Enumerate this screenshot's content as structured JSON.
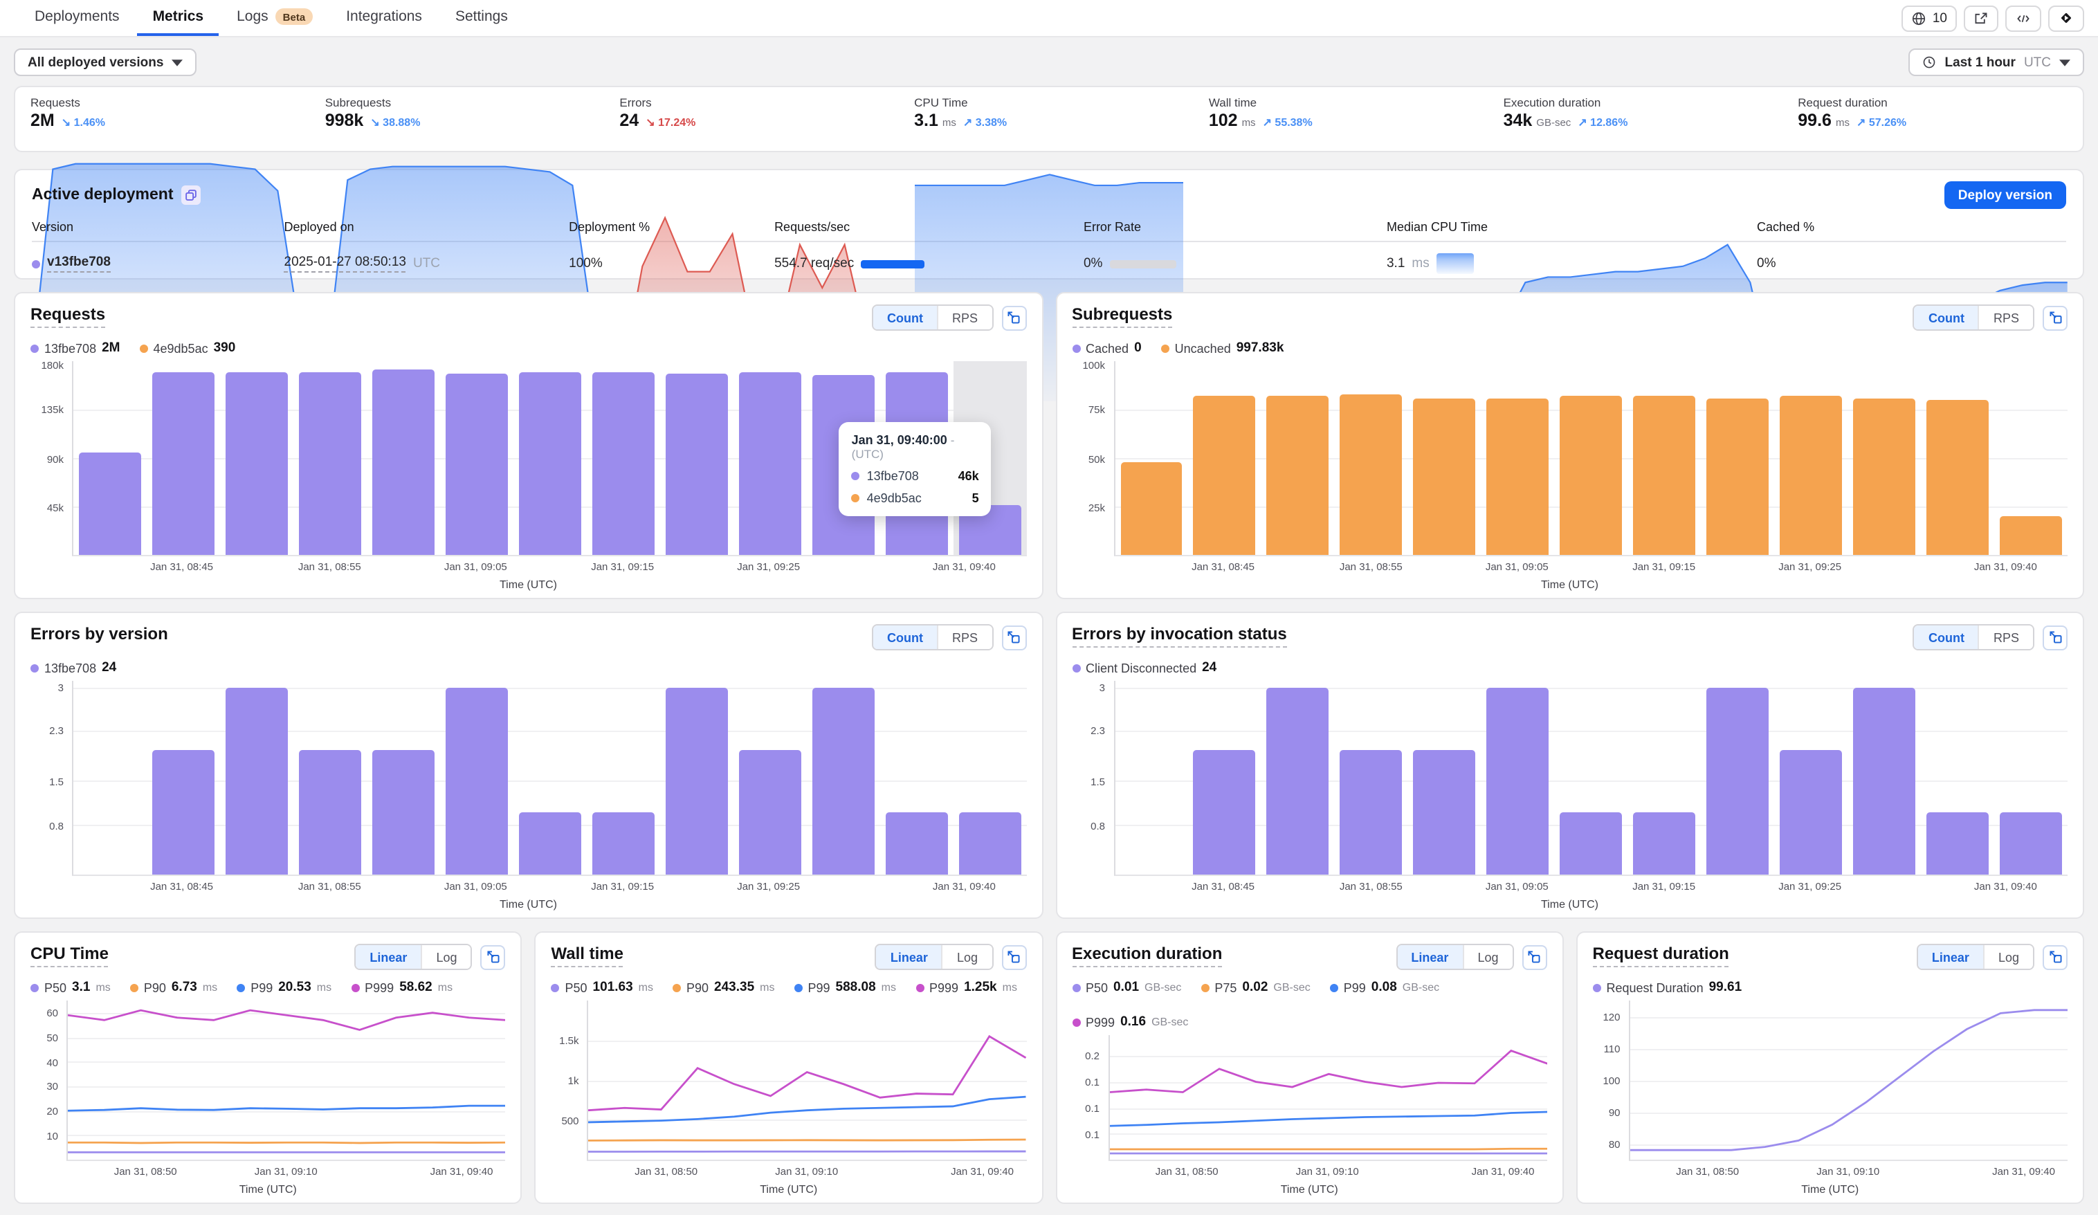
{
  "nav": {
    "tabs": [
      {
        "label": "Deployments",
        "active": false
      },
      {
        "label": "Metrics",
        "active": true
      },
      {
        "label": "Logs",
        "active": false,
        "badge": "Beta"
      },
      {
        "label": "Integrations",
        "active": false
      },
      {
        "label": "Settings",
        "active": false
      }
    ],
    "globe_count": "10"
  },
  "filters": {
    "versions": "All deployed versions",
    "time_range": "Last 1 hour",
    "time_zone": "UTC"
  },
  "colors": {
    "accent_blue": "#1467f2",
    "toggle_blue": "#1d64d8",
    "purple": "#9b8ced",
    "orange": "#f5a34f",
    "line_blue": "#3f83f4",
    "magenta": "#c750cb",
    "red": "#d64949"
  },
  "stats": [
    {
      "label": "Requests",
      "value": "2M",
      "unit": "",
      "arrow": "↘",
      "change": "1.46%",
      "change_color": "#4a90f5",
      "spark_color": "#3f83f4",
      "spark": [
        8,
        86,
        88,
        88,
        88,
        88,
        88,
        88,
        88,
        87,
        86,
        78,
        25
      ]
    },
    {
      "label": "Subrequests",
      "value": "998k",
      "unit": "",
      "arrow": "↘",
      "change": "38.88%",
      "change_color": "#4a90f5",
      "spark_color": "#3f83f4",
      "spark": [
        10,
        82,
        86,
        87,
        87,
        87,
        87,
        87,
        87,
        86,
        85,
        80,
        22
      ]
    },
    {
      "label": "Errors",
      "value": "24",
      "unit": "",
      "arrow": "↘",
      "change": "17.24%",
      "change_color": "#d64949",
      "spark_color": "#dd5a52",
      "spark": [
        5,
        50,
        68,
        48,
        48,
        62,
        22,
        22,
        58,
        42,
        58,
        22,
        22
      ]
    },
    {
      "label": "CPU Time",
      "value": "3.1",
      "unit": "ms",
      "arrow": "↗",
      "change": "3.38%",
      "change_color": "#4a90f5",
      "spark_color": "#3f83f4",
      "spark": [
        80,
        80,
        80,
        80,
        80,
        82,
        84,
        82,
        80,
        80,
        81,
        81,
        81
      ]
    },
    {
      "label": "Wall time",
      "value": "102",
      "unit": "ms",
      "arrow": "↗",
      "change": "55.38%",
      "change_color": "#4a90f5",
      "spark_color": "#3f83f4",
      "spark": [
        16,
        16,
        16,
        17,
        17,
        18,
        19,
        20,
        22,
        26,
        30,
        33,
        34
      ]
    },
    {
      "label": "Execution duration",
      "value": "34k",
      "unit": "GB-sec",
      "arrow": "↗",
      "change": "12.86%",
      "change_color": "#4a90f5",
      "spark_color": "#3f83f4",
      "spark": [
        28,
        44,
        46,
        46,
        47,
        48,
        48,
        49,
        50,
        53,
        58,
        44,
        8
      ]
    },
    {
      "label": "Request duration",
      "value": "99.6",
      "unit": "ms",
      "arrow": "↗",
      "change": "57.26%",
      "change_color": "#4a90f5",
      "spark_color": "#3f83f4",
      "spark": [
        22,
        22,
        22,
        22,
        23,
        25,
        28,
        32,
        37,
        41,
        43,
        44,
        44
      ]
    }
  ],
  "active_deployment": {
    "title": "Active deployment",
    "deploy_button": "Deploy version",
    "columns": [
      "Version",
      "Deployed on",
      "Deployment %",
      "Requests/sec",
      "Error Rate",
      "Median CPU Time",
      "Cached %"
    ],
    "row": {
      "version": "v13fbe708",
      "deployed_on": "2025-01-27 08:50:13",
      "tz": "UTC",
      "deployment_pct": "100%",
      "rps": "554.7 req/sec",
      "error_rate": "0%",
      "median_cpu": "3.1",
      "median_cpu_unit": "ms",
      "cached_pct": "0%"
    }
  },
  "toggles": {
    "count": "Count",
    "rps": "RPS",
    "linear": "Linear",
    "log": "Log"
  },
  "panels": {
    "requests": {
      "title": "Requests",
      "legend": [
        {
          "name": "13fbe708",
          "value": "2M",
          "color": "#9b8ced"
        },
        {
          "name": "4e9db5ac",
          "value": "390",
          "color": "#f5a34f"
        }
      ],
      "tooltip": {
        "title": "Jan 31, 09:40:00",
        "zone": "- (UTC)",
        "rows": [
          {
            "name": "13fbe708",
            "value": "46k",
            "color": "#9b8ced"
          },
          {
            "name": "4e9db5ac",
            "value": "5",
            "color": "#f5a34f"
          }
        ]
      }
    },
    "subrequests": {
      "title": "Subrequests",
      "legend": [
        {
          "name": "Cached",
          "value": "0",
          "color": "#9b8ced"
        },
        {
          "name": "Uncached",
          "value": "997.83k",
          "color": "#f5a34f"
        }
      ]
    },
    "errors_by_version": {
      "title": "Errors by version",
      "legend": [
        {
          "name": "13fbe708",
          "value": "24",
          "color": "#9b8ced"
        }
      ]
    },
    "errors_by_invocation": {
      "title": "Errors by invocation status",
      "legend": [
        {
          "name": "Client Disconnected",
          "value": "24",
          "color": "#9b8ced"
        }
      ]
    },
    "cpu_time": {
      "title": "CPU Time",
      "legend": [
        {
          "name": "P50",
          "value": "3.1",
          "unit": "ms",
          "color": "#9b8ced"
        },
        {
          "name": "P90",
          "value": "6.73",
          "unit": "ms",
          "color": "#f5a34f"
        },
        {
          "name": "P99",
          "value": "20.53",
          "unit": "ms",
          "color": "#3f83f4"
        },
        {
          "name": "P999",
          "value": "58.62",
          "unit": "ms",
          "color": "#c750cb"
        }
      ]
    },
    "wall_time": {
      "title": "Wall time",
      "legend": [
        {
          "name": "P50",
          "value": "101.63",
          "unit": "ms",
          "color": "#9b8ced"
        },
        {
          "name": "P90",
          "value": "243.35",
          "unit": "ms",
          "color": "#f5a34f"
        },
        {
          "name": "P99",
          "value": "588.08",
          "unit": "ms",
          "color": "#3f83f4"
        },
        {
          "name": "P999",
          "value": "1.25k",
          "unit": "ms",
          "color": "#c750cb"
        }
      ]
    },
    "execution_duration": {
      "title": "Execution duration",
      "legend": [
        {
          "name": "P50",
          "value": "0.01",
          "unit": "GB-sec",
          "color": "#9b8ced"
        },
        {
          "name": "P75",
          "value": "0.02",
          "unit": "GB-sec",
          "color": "#f5a34f"
        },
        {
          "name": "P99",
          "value": "0.08",
          "unit": "GB-sec",
          "color": "#3f83f4"
        },
        {
          "name": "P999",
          "value": "0.16",
          "unit": "GB-sec",
          "color": "#c750cb"
        }
      ]
    },
    "request_duration": {
      "title": "Request duration",
      "legend": [
        {
          "name": "Request Duration",
          "value": "99.61",
          "color": "#9b8ced"
        }
      ]
    }
  },
  "chart_data": [
    {
      "id": "requests",
      "type": "bar",
      "title": "Requests",
      "color": "#9b8ced",
      "ymax": 180,
      "yticks": [
        {
          "label": "180k",
          "v": 180
        },
        {
          "label": "135k",
          "v": 135
        },
        {
          "label": "90k",
          "v": 90
        },
        {
          "label": "45k",
          "v": 45
        }
      ],
      "values": [
        95,
        170,
        170,
        170,
        172,
        168,
        170,
        170,
        168,
        170,
        167,
        170,
        46
      ],
      "value_unit": "k",
      "hover_index": 12,
      "xticks": [
        "Jan 31, 08:45",
        "Jan 31, 08:55",
        "Jan 31, 09:05",
        "Jan 31, 09:15",
        "Jan 31, 09:25",
        "Jan 31, 09:40"
      ],
      "xtick_pos": [
        0.115,
        0.27,
        0.423,
        0.577,
        0.73,
        0.935
      ],
      "xlabel": "Time (UTC)"
    },
    {
      "id": "subrequests",
      "type": "bar",
      "title": "Subrequests",
      "color": "#f5a34f",
      "ymax": 100,
      "yticks": [
        {
          "label": "100k",
          "v": 100
        },
        {
          "label": "75k",
          "v": 75
        },
        {
          "label": "50k",
          "v": 50
        },
        {
          "label": "25k",
          "v": 25
        }
      ],
      "values": [
        48,
        82,
        82,
        83,
        81,
        81,
        82,
        82,
        81,
        82,
        81,
        80,
        20
      ],
      "value_unit": "k",
      "xticks": [
        "Jan 31, 08:45",
        "Jan 31, 08:55",
        "Jan 31, 09:05",
        "Jan 31, 09:15",
        "Jan 31, 09:25",
        "Jan 31, 09:40"
      ],
      "xtick_pos": [
        0.115,
        0.27,
        0.423,
        0.577,
        0.73,
        0.935
      ],
      "xlabel": "Time (UTC)"
    },
    {
      "id": "errors-version",
      "type": "bar",
      "title": "Errors by version",
      "color": "#9b8ced",
      "ymax": 3.1,
      "yticks": [
        {
          "label": "3",
          "v": 3
        },
        {
          "label": "2.3",
          "v": 2.3
        },
        {
          "label": "1.5",
          "v": 1.5
        },
        {
          "label": "0.8",
          "v": 0.8
        }
      ],
      "values": [
        0,
        2,
        3,
        2,
        2,
        3,
        1,
        1,
        3,
        2,
        3,
        1,
        1
      ],
      "xticks": [
        "Jan 31, 08:45",
        "Jan 31, 08:55",
        "Jan 31, 09:05",
        "Jan 31, 09:15",
        "Jan 31, 09:25",
        "Jan 31, 09:40"
      ],
      "xtick_pos": [
        0.115,
        0.27,
        0.423,
        0.577,
        0.73,
        0.935
      ],
      "xlabel": "Time (UTC)"
    },
    {
      "id": "errors-invocation",
      "type": "bar",
      "title": "Errors by invocation status",
      "color": "#9b8ced",
      "ymax": 3.1,
      "yticks": [
        {
          "label": "3",
          "v": 3
        },
        {
          "label": "2.3",
          "v": 2.3
        },
        {
          "label": "1.5",
          "v": 1.5
        },
        {
          "label": "0.8",
          "v": 0.8
        }
      ],
      "values": [
        0,
        2,
        3,
        2,
        2,
        3,
        1,
        1,
        3,
        2,
        3,
        1,
        1
      ],
      "xticks": [
        "Jan 31, 08:45",
        "Jan 31, 08:55",
        "Jan 31, 09:05",
        "Jan 31, 09:15",
        "Jan 31, 09:25",
        "Jan 31, 09:40"
      ],
      "xtick_pos": [
        0.115,
        0.27,
        0.423,
        0.577,
        0.73,
        0.935
      ],
      "xlabel": "Time (UTC)"
    },
    {
      "id": "cpu-time",
      "type": "line",
      "title": "CPU Time",
      "ymax": 65,
      "yticks": [
        {
          "label": "60",
          "v": 60
        },
        {
          "label": "50",
          "v": 50
        },
        {
          "label": "40",
          "v": 40
        },
        {
          "label": "30",
          "v": 30
        },
        {
          "label": "20",
          "v": 20
        },
        {
          "label": "10",
          "v": 10
        }
      ],
      "series": [
        {
          "name": "P50",
          "color": "#9b8ced",
          "values": [
            3,
            3,
            3,
            3,
            3,
            3,
            3,
            3,
            3,
            3,
            3,
            3,
            3
          ]
        },
        {
          "name": "P90",
          "color": "#f5a34f",
          "values": [
            7,
            7,
            6.8,
            7,
            7,
            6.9,
            7,
            7,
            6.8,
            7,
            7,
            6.9,
            7
          ]
        },
        {
          "name": "P99",
          "color": "#3f83f4",
          "values": [
            20,
            20.3,
            21,
            20.4,
            20.3,
            21,
            20.8,
            20.5,
            21,
            21,
            21.3,
            22,
            22
          ]
        },
        {
          "name": "P999",
          "color": "#c750cb",
          "values": [
            59,
            57,
            61,
            58,
            57,
            61,
            59,
            57,
            53,
            58,
            60,
            58,
            57
          ]
        }
      ],
      "xticks": [
        "Jan 31, 08:50",
        "Jan 31, 09:10",
        "Jan 31, 09:40"
      ],
      "xtick_pos": [
        0.18,
        0.5,
        0.9
      ],
      "xlabel": "Time (UTC)"
    },
    {
      "id": "wall-time",
      "type": "line",
      "title": "Wall time",
      "ymax": 2000,
      "yticks": [
        {
          "label": "1.5k",
          "v": 1500
        },
        {
          "label": "1k",
          "v": 1000
        },
        {
          "label": "500",
          "v": 500
        }
      ],
      "series": [
        {
          "name": "P50",
          "color": "#9b8ced",
          "values": [
            100,
            100,
            101,
            101,
            102,
            102,
            102,
            102,
            102,
            103,
            103,
            104,
            104
          ]
        },
        {
          "name": "P90",
          "color": "#f5a34f",
          "values": [
            240,
            242,
            244,
            243,
            243,
            244,
            245,
            244,
            243,
            244,
            245,
            250,
            252
          ]
        },
        {
          "name": "P99",
          "color": "#3f83f4",
          "values": [
            470,
            480,
            490,
            510,
            540,
            590,
            620,
            640,
            650,
            660,
            670,
            760,
            790
          ]
        },
        {
          "name": "P999",
          "color": "#c750cb",
          "values": [
            620,
            650,
            630,
            1150,
            950,
            800,
            1100,
            950,
            780,
            830,
            820,
            1550,
            1280
          ]
        }
      ],
      "xticks": [
        "Jan 31, 08:50",
        "Jan 31, 09:10",
        "Jan 31, 09:40"
      ],
      "xtick_pos": [
        0.18,
        0.5,
        0.9
      ],
      "xlabel": "Time (UTC)"
    },
    {
      "id": "execution-duration",
      "type": "line",
      "title": "Execution duration",
      "ymax": 0.24,
      "yticks": [
        {
          "label": "0.2",
          "v": 0.2
        },
        {
          "label": "0.1",
          "v": 0.15
        },
        {
          "label": "0.1",
          "v": 0.1
        },
        {
          "label": "0.1",
          "v": 0.05
        }
      ],
      "series": [
        {
          "name": "P50",
          "color": "#9b8ced",
          "values": [
            0.012,
            0.012,
            0.012,
            0.012,
            0.012,
            0.012,
            0.012,
            0.012,
            0.012,
            0.012,
            0.012,
            0.012,
            0.012
          ]
        },
        {
          "name": "P75",
          "color": "#f5a34f",
          "values": [
            0.02,
            0.02,
            0.02,
            0.02,
            0.02,
            0.02,
            0.02,
            0.02,
            0.02,
            0.02,
            0.02,
            0.021,
            0.021
          ]
        },
        {
          "name": "P99",
          "color": "#3f83f4",
          "values": [
            0.065,
            0.067,
            0.07,
            0.072,
            0.075,
            0.078,
            0.08,
            0.082,
            0.083,
            0.084,
            0.085,
            0.09,
            0.092
          ]
        },
        {
          "name": "P999",
          "color": "#c750cb",
          "values": [
            0.13,
            0.135,
            0.13,
            0.175,
            0.15,
            0.14,
            0.165,
            0.15,
            0.14,
            0.148,
            0.147,
            0.21,
            0.185
          ]
        }
      ],
      "xticks": [
        "Jan 31, 08:50",
        "Jan 31, 09:10",
        "Jan 31, 09:40"
      ],
      "xtick_pos": [
        0.18,
        0.5,
        0.9
      ],
      "xlabel": "Time (UTC)"
    },
    {
      "id": "request-duration",
      "type": "line",
      "title": "Request duration",
      "ymin": 75,
      "ymax": 125,
      "yticks": [
        {
          "label": "120",
          "v": 120
        },
        {
          "label": "110",
          "v": 110
        },
        {
          "label": "100",
          "v": 100
        },
        {
          "label": "90",
          "v": 90
        },
        {
          "label": "80",
          "v": 80
        }
      ],
      "series": [
        {
          "name": "Request Duration",
          "color": "#9b8ced",
          "values": [
            78,
            78,
            78,
            78,
            79,
            81,
            86,
            93,
            101,
            109,
            116,
            121,
            122,
            122
          ]
        }
      ],
      "xticks": [
        "Jan 31, 08:50",
        "Jan 31, 09:10",
        "Jan 31, 09:40"
      ],
      "xtick_pos": [
        0.18,
        0.5,
        0.9
      ],
      "xlabel": "Time (UTC)"
    }
  ]
}
